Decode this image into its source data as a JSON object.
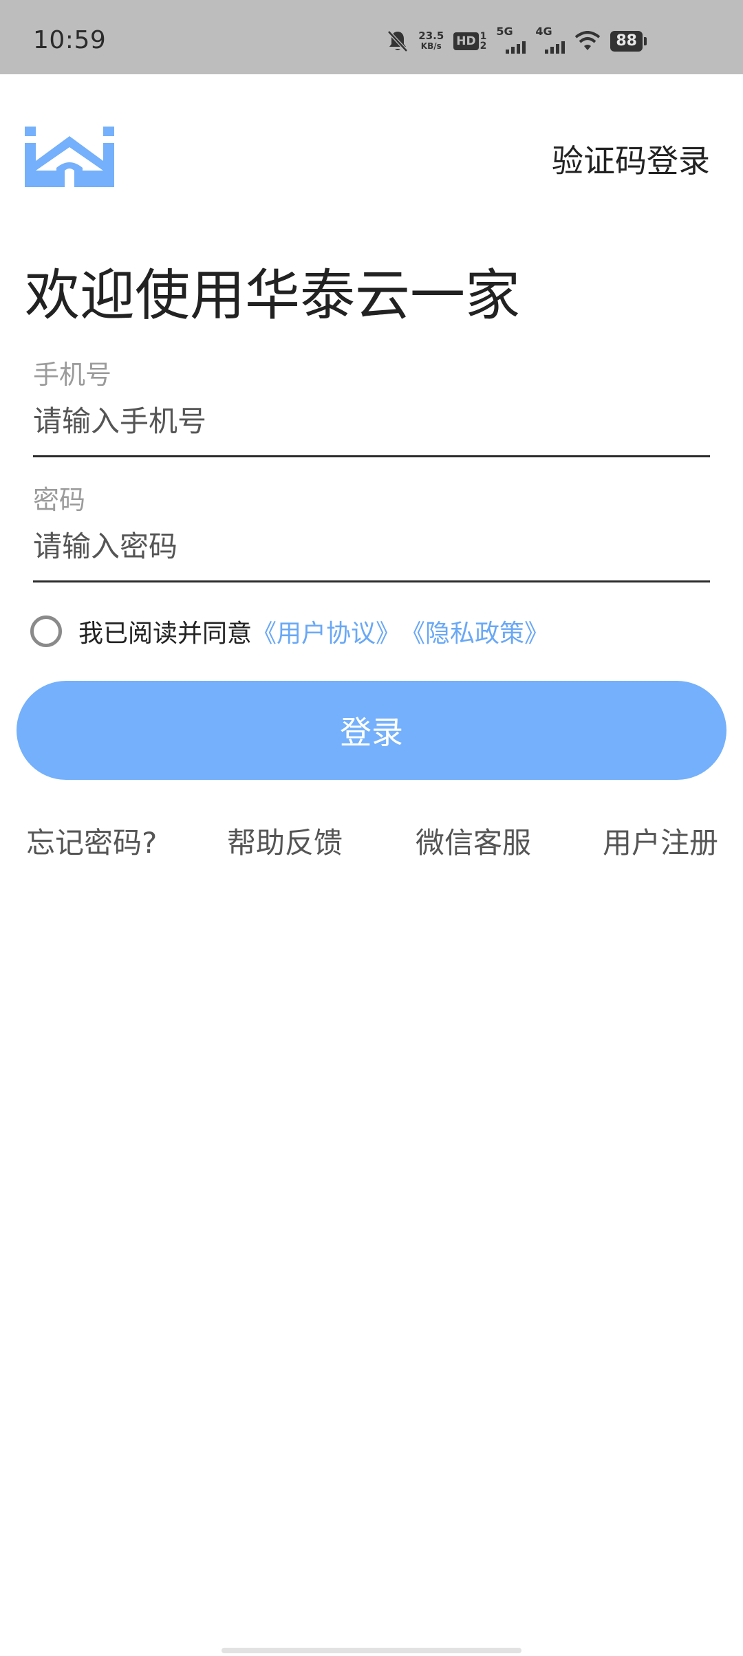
{
  "status_bar": {
    "time": "10:59",
    "net_speed_value": "23.5",
    "net_speed_unit": "KB/s",
    "hd_label": "HD",
    "hd_sim_top": "1",
    "hd_sim_bottom": "2",
    "signal1_label": "5G",
    "signal2_label": "4G",
    "battery": "88"
  },
  "header": {
    "logo_icon": "home-logo-icon",
    "top_link": "验证码登录"
  },
  "welcome_title": "欢迎使用华泰云一家",
  "form": {
    "phone_label": "手机号",
    "phone_placeholder": "请输入手机号",
    "phone_value": "",
    "password_label": "密码",
    "password_placeholder": "请输入密码",
    "password_value": ""
  },
  "agreement": {
    "text": "我已阅读并同意",
    "user_agreement": "《用户协议》",
    "privacy_policy": "《隐私政策》"
  },
  "login_button": "登录",
  "bottom_links": {
    "forgot": "忘记密码?",
    "help": "帮助反馈",
    "wechat": "微信客服",
    "register": "用户注册"
  },
  "colors": {
    "accent": "#74b0fb",
    "link": "#69a8f6",
    "status_bar_bg": "#bdbdbd"
  }
}
